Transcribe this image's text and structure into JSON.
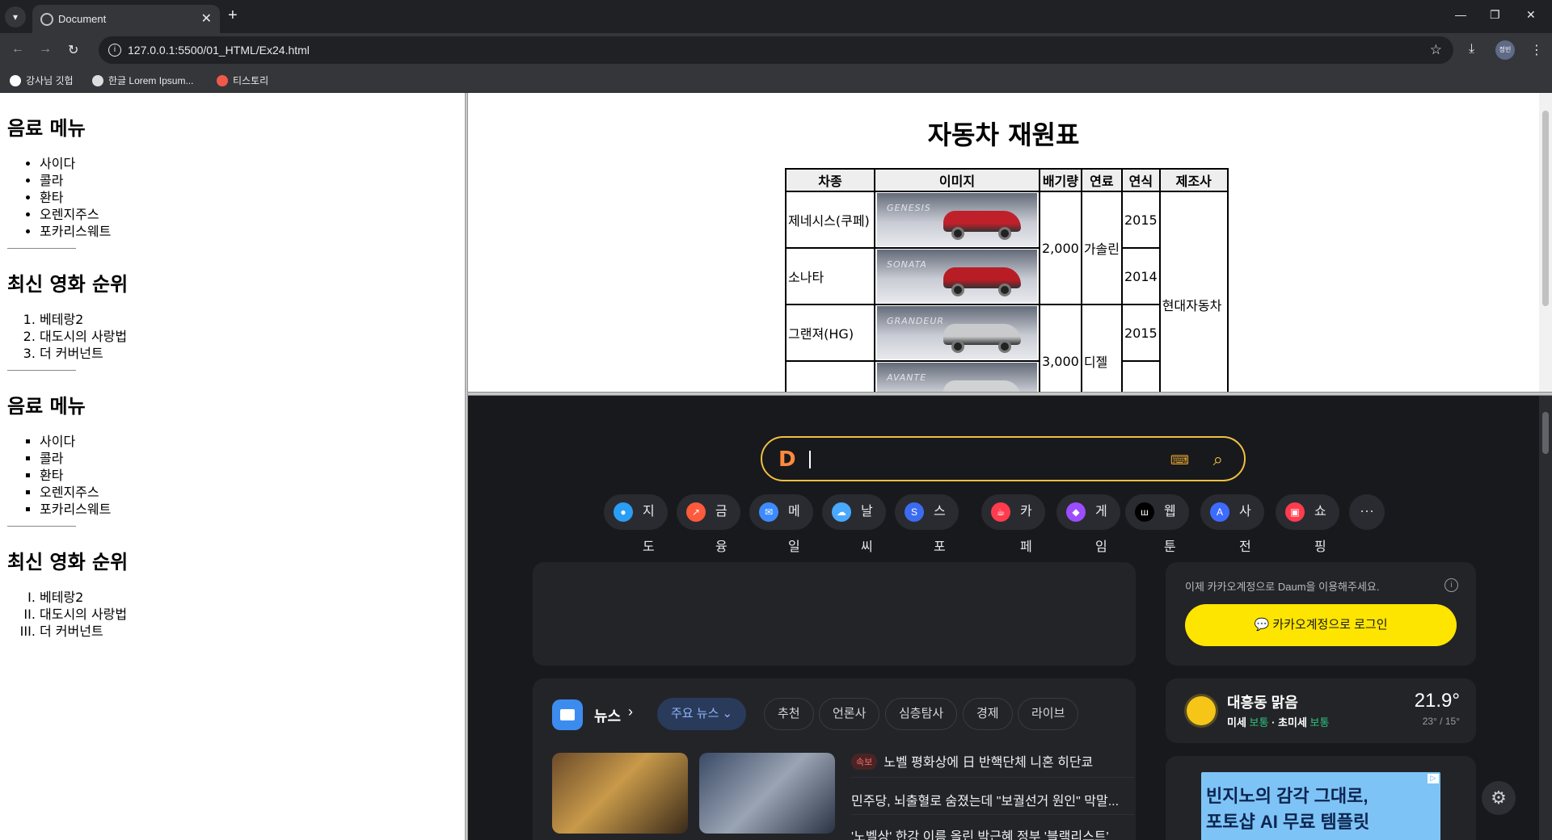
{
  "browser": {
    "tab_title": "Document",
    "url": "127.0.0.1:5500/01_HTML/Ex24.html",
    "profile_label": "정빈",
    "bookmarks": [
      "강사님 깃헙",
      "한글 Lorem Ipsum...",
      "티스토리"
    ]
  },
  "left_doc": {
    "sections": [
      {
        "heading": "음료 메뉴",
        "items": [
          "사이다",
          "콜라",
          "환타",
          "오렌지주스",
          "포카리스웨트"
        ]
      },
      {
        "heading": "최신 영화 순위",
        "items": [
          "베테랑2",
          "대도시의 사랑법",
          "더 커버넌트"
        ]
      },
      {
        "heading": "음료 메뉴",
        "items": [
          "사이다",
          "콜라",
          "환타",
          "오렌지주스",
          "포카리스웨트"
        ]
      },
      {
        "heading": "최신 영화 순위",
        "items": [
          "베테랑2",
          "대도시의 사랑법",
          "더 커버넌트"
        ]
      }
    ]
  },
  "car_spec": {
    "title": "자동차 재원표",
    "headers": [
      "차종",
      "이미지",
      "배기량",
      "연료",
      "연식",
      "제조사"
    ],
    "rows": [
      {
        "model": "제네시스(쿠페)",
        "brand_text": "GENESIS",
        "color": "#c0202a"
      },
      {
        "model": "소나타",
        "brand_text": "SONATA",
        "color": "#b81c24"
      },
      {
        "model": "그랜져(HG)",
        "brand_text": "GRANDEUR",
        "color": "#c8cacc"
      },
      {
        "model": "",
        "brand_text": "AVANTE",
        "color": "#d0d2d4"
      }
    ],
    "displacement_a": "2,000",
    "fuel_a": "가솔린",
    "year_1": "2015",
    "year_2": "2014",
    "displacement_b": "3,000",
    "fuel_b": "디젤",
    "year_3": "2015",
    "maker": "현대자동차"
  },
  "daum": {
    "quick_links": [
      {
        "label": "지도",
        "color": "#2a9df4",
        "glyph": "●"
      },
      {
        "label": "금융",
        "color": "#ff5a3c",
        "glyph": "↗"
      },
      {
        "label": "메일",
        "color": "#3d8bfd",
        "glyph": "✉"
      },
      {
        "label": "날씨",
        "color": "#4aa8ff",
        "glyph": "☁"
      },
      {
        "label": "스포츠",
        "color": "#3b6cf0",
        "glyph": "S"
      },
      {
        "label": "카페",
        "color": "#ff3b4e",
        "glyph": "☕"
      },
      {
        "label": "게임",
        "color": "#9b4dff",
        "glyph": "◆"
      },
      {
        "label": "웹툰",
        "color": "#000000",
        "glyph": "ш"
      },
      {
        "label": "사전",
        "color": "#3d6bff",
        "glyph": "A"
      },
      {
        "label": "쇼핑",
        "color": "#ff3b4e",
        "glyph": "▣"
      }
    ],
    "more_label": "···",
    "login": {
      "text": "이제 카카오계정으로 Daum을 이용해주세요.",
      "button": "카카오계정으로 로그인"
    },
    "news": {
      "title": "뉴스",
      "tabs": [
        "주요 뉴스",
        "추천",
        "언론사",
        "심층탐사",
        "경제",
        "라이브"
      ],
      "breaking_badge": "속보",
      "headlines": [
        "노벨 평화상에 日 반핵단체 니혼 히단쿄",
        "민주당, 뇌출혈로 숨졌는데 \"보궐선거 원인\" 막말...",
        "'노벨상' 한강 이름 올린 박근혜 정부 '블랙리스트'"
      ]
    },
    "weather": {
      "location": "대흥동 맑음",
      "fine_dust_label": "미세",
      "fine_dust": "보통",
      "ultra_dust_label": "초미세",
      "ultra_dust": "보통",
      "temp": "21.9°",
      "range": "23° / 15°"
    },
    "ad": {
      "line1": "빈지노의 감각 그대로,",
      "line2": "포토샵 AI 무료 템플릿"
    }
  }
}
